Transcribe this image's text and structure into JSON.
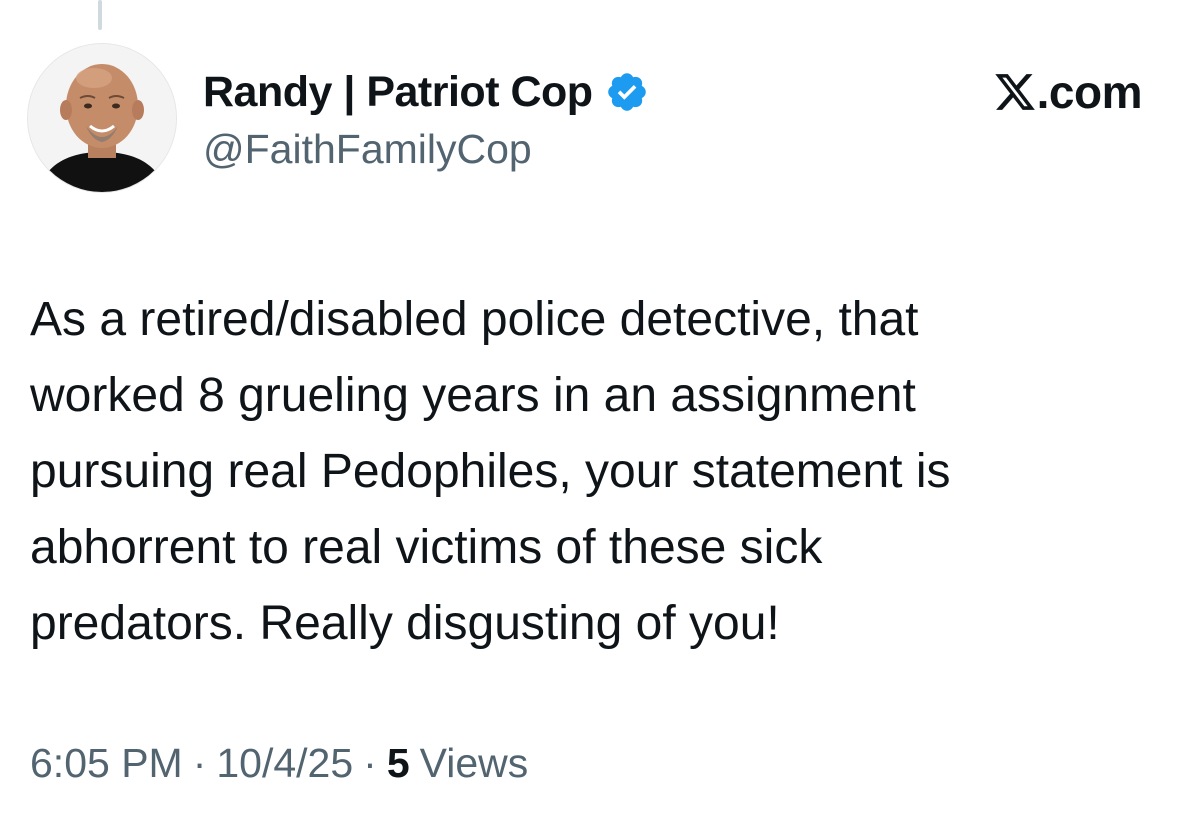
{
  "author": {
    "display_name": "Randy | Patriot Cop",
    "handle": "@FaithFamilyCop",
    "verified": true,
    "verified_color": "#1d9bf0"
  },
  "watermark": {
    "text": ".com",
    "icon": "x-logo-icon"
  },
  "tweet": {
    "text": "As a retired/disabled police detective, that\nworked 8 grueling years in an assignment\npursuing real Pedophiles, your statement is\nabhorrent to real victims of these sick\npredators. Really disgusting of you!"
  },
  "meta": {
    "time": "6:05 PM",
    "separator": "·",
    "date": "10/4/25",
    "views_count": "5",
    "views_label": "Views"
  },
  "colors": {
    "text_primary": "#0f1419",
    "text_secondary": "#536471",
    "thread_line": "#cfd9de"
  }
}
